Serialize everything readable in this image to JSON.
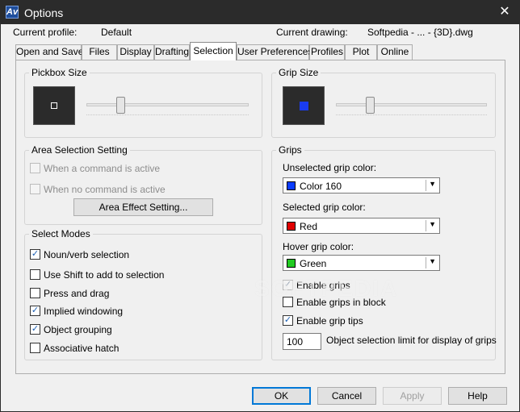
{
  "window": {
    "title": "Options",
    "app_icon_glyph": "Av",
    "close_glyph": "✕"
  },
  "header": {
    "current_profile_label": "Current profile:",
    "current_profile_value": "Default",
    "current_drawing_label": "Current drawing:",
    "current_drawing_value": "Softpedia - ... - {3D}.dwg"
  },
  "tabs": [
    {
      "label": "Open and Save"
    },
    {
      "label": "Files"
    },
    {
      "label": "Display"
    },
    {
      "label": "Drafting"
    },
    {
      "label": "Selection"
    },
    {
      "label": "User Preferences"
    },
    {
      "label": "Profiles"
    },
    {
      "label": "Plot"
    },
    {
      "label": "Online"
    }
  ],
  "active_tab": "Selection",
  "pickbox": {
    "title": "Pickbox Size"
  },
  "gripsize": {
    "title": "Grip Size"
  },
  "area_selection": {
    "title": "Area Selection Setting",
    "when_active": "When a command is active",
    "when_no_active": "When no command is active",
    "effect_button": "Area Effect Setting..."
  },
  "select_modes": {
    "title": "Select Modes",
    "items": [
      {
        "label": "Noun/verb selection",
        "checked": true
      },
      {
        "label": "Use Shift to add to selection",
        "checked": false
      },
      {
        "label": "Press and drag",
        "checked": false
      },
      {
        "label": "Implied windowing",
        "checked": true
      },
      {
        "label": "Object grouping",
        "checked": true
      },
      {
        "label": "Associative hatch",
        "checked": false
      }
    ]
  },
  "grips": {
    "title": "Grips",
    "unselected_label": "Unselected grip color:",
    "unselected_value": "Color 160",
    "selected_label": "Selected grip color:",
    "selected_value": "Red",
    "hover_label": "Hover grip color:",
    "hover_value": "Green",
    "enable_grips": "Enable grips",
    "enable_grips_block": "Enable grips in block",
    "enable_grip_tips": "Enable grip tips",
    "limit_value": "100",
    "limit_label": "Object selection limit for display of grips"
  },
  "colors": {
    "color160": "#0a3cff",
    "red": "#e00000",
    "green": "#22cc22",
    "pickbox_bg": "#2b2b2b",
    "gripsize_marker": "#1a3cf0"
  },
  "footer": {
    "ok": "OK",
    "cancel": "Cancel",
    "apply": "Apply",
    "help": "Help"
  },
  "watermark": "SOFTPEDIA"
}
